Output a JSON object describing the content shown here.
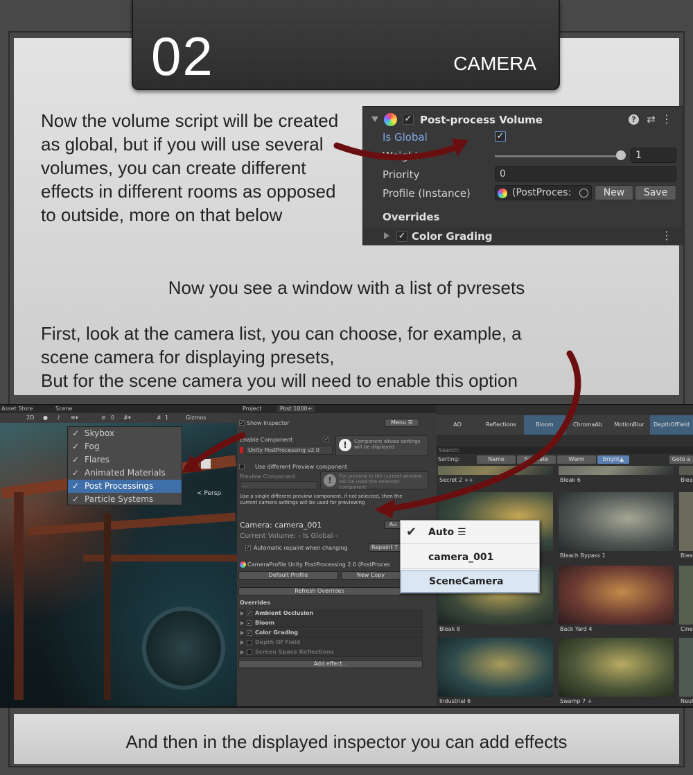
{
  "header": {
    "number": "02",
    "title": "CAMERA"
  },
  "text": {
    "paragraph1": "Now the volume script will be created as global, but if you will use several volumes, you can create different effects in different rooms as opposed to outside, more on that below",
    "paragraph2": "Now you see a window with a list of pvresets",
    "paragraph3_line1": "First, look at the camera list, you can choose, for example, a",
    "paragraph3_line2": "scene camera for displaying presets,",
    "paragraph3_line3": "But for the scene camera you will need to enable this option",
    "footer": "And then in the displayed inspector you can add effects"
  },
  "ppv": {
    "title": "Post-process Volume",
    "is_global_label": "Is Global",
    "is_global": true,
    "weight_label": "Weight",
    "weight_value": "1",
    "priority_label": "Priority",
    "priority_value": "0",
    "profile_label": "Profile (Instance)",
    "profile_value": "(PostProces:",
    "new_label": "New",
    "save_label": "Save",
    "overrides_label": "Overrides",
    "color_grading_label": "Color Grading"
  },
  "scene_panel": {
    "tab_asset_store": "Asset Store",
    "tab_scene": "Scene",
    "btn_2d": "2D",
    "layers_count": "0",
    "grid_count": "1",
    "gizmos_label": "Gizmos",
    "persp_label": "< Persp",
    "dropdown_items": [
      "Skybox",
      "Fog",
      "Flares",
      "Animated Materials",
      "Post Processings",
      "Particle Systems"
    ],
    "dropdown_selected": "Post Processings"
  },
  "inspector": {
    "tab_project": "Project",
    "tab_post": "Post 1000+",
    "show_inspector": "Show Inspector",
    "menu_label": "Menu ☰",
    "enable_component_label": "Enable Component",
    "component_select": "Unity PostProcessing v2.0",
    "component_note": "Component whose settings will be displayed",
    "use_different_preview": "Use different Preview component",
    "preview_component_label": "Preview Component",
    "preview_select": "...",
    "preview_note": "For preview in the current window will be used the selected component",
    "use_single_note": "Use a single different preview component, if not selected, then the current camera settings will be used for previewing",
    "camera_label": "Camera: camera_001",
    "current_volume_label": "Current Volume: - Is Global -",
    "auto_btn": "Au",
    "auto_repaint_label": "Automatic repaint when changing",
    "repaint_btn": "Repaint T",
    "profile_line": "CameraProfile Unity PostProcessing 2.0 (PostProces",
    "default_profile_btn": "Default Profile",
    "new_copy_btn": "New Copy",
    "refresh_overrides_btn": "Refresh Overrides",
    "overrides_label": "Overrides",
    "overrides": [
      {
        "name": "Ambient Occlusion",
        "enabled": true
      },
      {
        "name": "Bloom",
        "enabled": true
      },
      {
        "name": "Color Grading",
        "enabled": true
      },
      {
        "name": "Depth Of Field",
        "enabled": false
      },
      {
        "name": "Screen Space Reflections",
        "enabled": false
      }
    ],
    "add_effect_btn": "Add effect..."
  },
  "preset_grid": {
    "effects": [
      "AO",
      "Reflections",
      "Bloom",
      "ChromaAb",
      "MotionBlur",
      "DepthOfField"
    ],
    "active_effects": [
      "Bloom",
      "DepthOfField"
    ],
    "search_placeholder": "Search:",
    "sorting_label": "Sorting:",
    "sort_buttons": [
      "Name",
      "Saturate",
      "Warm",
      "Bright▲"
    ],
    "sort_active": "Bright▲",
    "goto_label": "Goto a",
    "presets_row1": [
      "Secret 2 ++",
      "Bleak 6",
      "Blea"
    ],
    "presets_row2": [
      "",
      "Bleach Bypass 1",
      "Blea"
    ],
    "presets_row3": [
      "Bleak 8",
      "Back Yard 4",
      "Cine"
    ],
    "presets_row4": [
      "Industrial 6",
      "Swamp 7 +",
      "Neut"
    ]
  },
  "camera_popup": {
    "items": [
      "Auto ☰",
      "camera_001",
      "SceneCamera"
    ],
    "checked": "Auto ☰",
    "highlighted": "SceneCamera"
  },
  "colors": {
    "arrow": "#6a0f0f",
    "unity_blue": "#3f6fa8",
    "inspector_bg": "#383838"
  }
}
